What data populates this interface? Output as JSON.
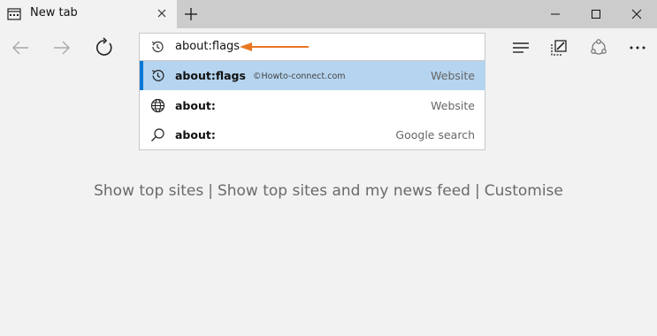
{
  "tab": {
    "title": "New tab"
  },
  "address_bar": {
    "value": "about:flags"
  },
  "suggestions": [
    {
      "label": "about:flags",
      "kind": "Website",
      "icon": "history-icon"
    },
    {
      "label": "about:",
      "kind": "Website",
      "icon": "globe-icon"
    },
    {
      "label": "about:",
      "kind": "Google search",
      "icon": "search-icon"
    }
  ],
  "watermark": "©Howto-connect.com",
  "page_links": {
    "show_top_sites": "Show top sites",
    "sep1": "|",
    "show_top_sites_news": "Show top sites and my news feed",
    "sep2": "|",
    "customise": "Customise"
  },
  "colors": {
    "accent": "#0078d7",
    "highlight": "#b5d4ef",
    "annotation_arrow": "#e87722"
  }
}
